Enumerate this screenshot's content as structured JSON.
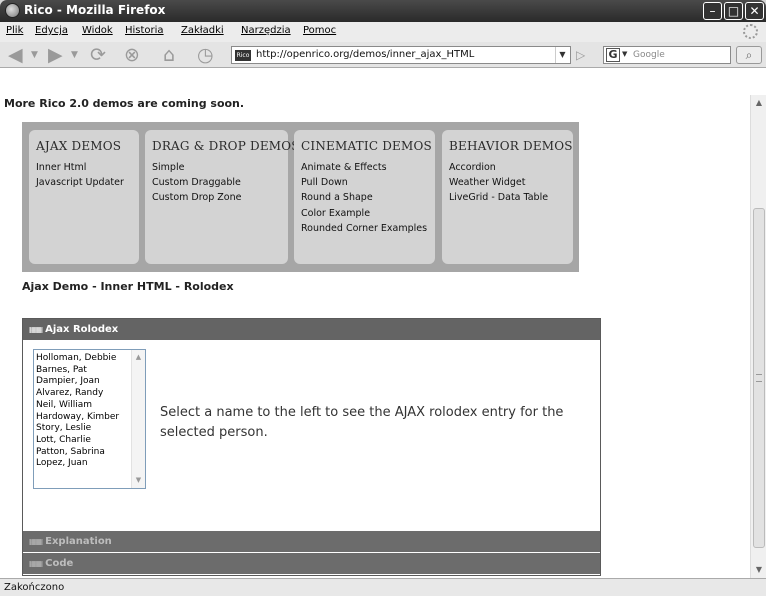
{
  "window": {
    "title": "Rico - Mozilla Firefox"
  },
  "menu": [
    "Plik",
    "Edycja",
    "Widok",
    "Historia",
    "Zakładki",
    "Narzędzia",
    "Pomoc"
  ],
  "toolbar": {
    "url": "http://openrico.org/demos/inner_ajax_HTML",
    "site_icon_text": "Rico",
    "search_placeholder": "Google",
    "search_engine_letter": "G"
  },
  "page": {
    "coming_soon": "More Rico 2.0 demos are coming soon.",
    "demo_groups": [
      {
        "title": "AJAX DEMOS",
        "links": [
          "Inner Html",
          "Javascript Updater"
        ]
      },
      {
        "title": "DRAG & DROP DEMOS",
        "links": [
          "Simple",
          "Custom Draggable",
          "Custom Drop Zone"
        ]
      },
      {
        "title": "CINEMATIC DEMOS",
        "links": [
          "Animate & Effects",
          "Pull Down",
          "Round a Shape",
          "Color Example",
          "Rounded Corner Examples"
        ]
      },
      {
        "title": "BEHAVIOR DEMOS",
        "links": [
          "Accordion",
          "Weather Widget",
          "LiveGrid - Data Table"
        ]
      }
    ],
    "demo_heading": "Ajax Demo - Inner HTML - Rolodex",
    "panels": {
      "rolodex": "Ajax Rolodex",
      "explanation": "Explanation",
      "code": "Code"
    },
    "names": [
      "Holloman, Debbie",
      "Barnes, Pat",
      "Dampier, Joan",
      "Alvarez, Randy",
      "Neil, William",
      "Hardoway, Kimber",
      "Story, Leslie",
      "Lott, Charlie",
      "Patton, Sabrina",
      "Lopez, Juan"
    ],
    "prompt": "Select a name to the left to see the AJAX rolodex entry for the selected person."
  },
  "status": {
    "text": "Zakończono"
  }
}
